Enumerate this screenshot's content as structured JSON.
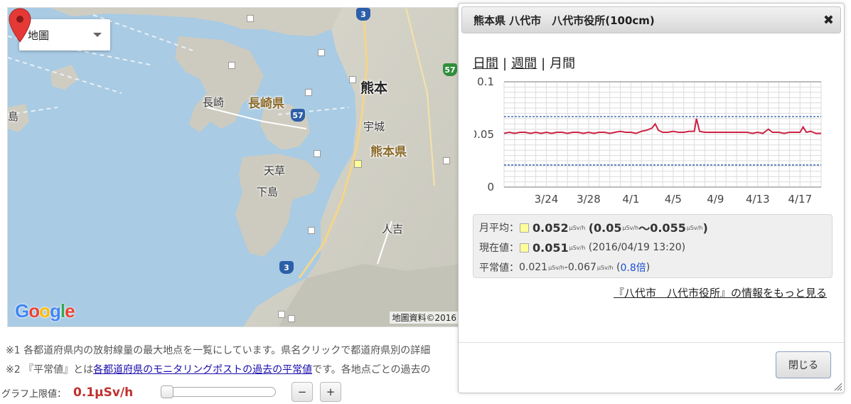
{
  "map": {
    "type_select": "地圖",
    "credit": "地圖資料©2016",
    "google": "Google",
    "labels": {
      "kumamoto": "熊本",
      "nagasaki_pref": "長崎県",
      "kumamoto_pref": "熊本県",
      "nagasaki": "長崎",
      "uto": "宇城",
      "amakusa": "天草",
      "shimoshima": "下島",
      "hitoyoshi": "人吉",
      "island": "島"
    },
    "roads": [
      "3",
      "57",
      "57",
      "3"
    ]
  },
  "notes": {
    "n1": "※1 各都道府県内の放射線量の最大地点を一覧にしています。県名クリックで都道府県別の詳細",
    "n2_prefix": "※2 『平常値』とは",
    "n2_link": "各都道府県のモニタリングポストの過去の平常値",
    "n2_suffix": "です。各地点ごとの過去の"
  },
  "graph_limit": {
    "label": "グラフ上限値：",
    "value": "0.1μSv/h",
    "minus": "−",
    "plus": "+"
  },
  "dialog": {
    "title": "熊本県 八代市　八代市役所(100cm)",
    "close_icon": "✖",
    "tabs": [
      {
        "label": "日間",
        "link": true
      },
      {
        "label": "週間",
        "link": true
      },
      {
        "label": "月間",
        "link": false
      }
    ],
    "tab_sep": "|",
    "monthly_label": "月平均：",
    "monthly_value": "0.052",
    "monthly_range_open": "(",
    "monthly_min": "0.05",
    "monthly_tilde": "〜",
    "monthly_max": "0.055",
    "monthly_range_close": ")",
    "current_label": "現在値：",
    "current_value": "0.051",
    "current_time": "(2016/04/19 13:20)",
    "normal_label": "平常値：",
    "normal_min": "0.021",
    "normal_dash": "-",
    "normal_max": "0.067",
    "normal_ratio_open": "(",
    "normal_ratio": "0.8倍",
    "normal_ratio_close": ")",
    "unit": "μSv/h",
    "more_link": "『八代市　八代市役所』の情報をもっと見る",
    "close_button": "閉じる"
  },
  "chart_data": {
    "type": "line",
    "ylim": [
      0,
      0.1
    ],
    "yticks": [
      "0",
      "0.05",
      "0.1"
    ],
    "xticks": [
      "3/24",
      "3/28",
      "4/1",
      "4/5",
      "4/9",
      "4/13",
      "4/17"
    ],
    "xtick_days": [
      4,
      8,
      12,
      16,
      20,
      24,
      28
    ],
    "xrange_days": [
      0,
      30
    ],
    "reference_lines": [
      0.021,
      0.067
    ],
    "series": [
      {
        "color": "#cc2244",
        "points": [
          [
            0,
            0.051
          ],
          [
            0.5,
            0.052
          ],
          [
            1,
            0.051
          ],
          [
            1.5,
            0.052
          ],
          [
            2,
            0.052
          ],
          [
            2.5,
            0.051
          ],
          [
            3,
            0.052
          ],
          [
            3.5,
            0.051
          ],
          [
            4,
            0.052
          ],
          [
            4.5,
            0.051
          ],
          [
            5,
            0.052
          ],
          [
            5.5,
            0.052
          ],
          [
            6,
            0.051
          ],
          [
            6.5,
            0.052
          ],
          [
            7,
            0.052
          ],
          [
            7.5,
            0.051
          ],
          [
            8,
            0.052
          ],
          [
            8.5,
            0.051
          ],
          [
            9,
            0.052
          ],
          [
            9.5,
            0.052
          ],
          [
            10,
            0.051
          ],
          [
            10.5,
            0.052
          ],
          [
            11,
            0.053
          ],
          [
            11.5,
            0.052
          ],
          [
            12,
            0.052
          ],
          [
            12.5,
            0.051
          ],
          [
            13,
            0.053
          ],
          [
            13.5,
            0.054
          ],
          [
            14,
            0.056
          ],
          [
            14.3,
            0.06
          ],
          [
            14.6,
            0.054
          ],
          [
            15,
            0.052
          ],
          [
            15.5,
            0.052
          ],
          [
            16,
            0.053
          ],
          [
            16.5,
            0.052
          ],
          [
            17,
            0.052
          ],
          [
            17.5,
            0.053
          ],
          [
            18,
            0.053
          ],
          [
            18.2,
            0.065
          ],
          [
            18.5,
            0.053
          ],
          [
            19,
            0.052
          ],
          [
            19.5,
            0.052
          ],
          [
            20,
            0.052
          ],
          [
            20.5,
            0.052
          ],
          [
            21,
            0.052
          ],
          [
            21.5,
            0.052
          ],
          [
            22,
            0.052
          ],
          [
            22.5,
            0.052
          ],
          [
            23,
            0.052
          ],
          [
            23.5,
            0.051
          ],
          [
            24,
            0.052
          ],
          [
            24.5,
            0.051
          ],
          [
            25,
            0.055
          ],
          [
            25.4,
            0.052
          ],
          [
            26,
            0.052
          ],
          [
            26.5,
            0.051
          ],
          [
            27,
            0.052
          ],
          [
            27.5,
            0.052
          ],
          [
            28,
            0.052
          ],
          [
            28.3,
            0.057
          ],
          [
            28.6,
            0.052
          ],
          [
            29,
            0.053
          ],
          [
            29.5,
            0.051
          ],
          [
            30,
            0.051
          ]
        ]
      }
    ]
  }
}
